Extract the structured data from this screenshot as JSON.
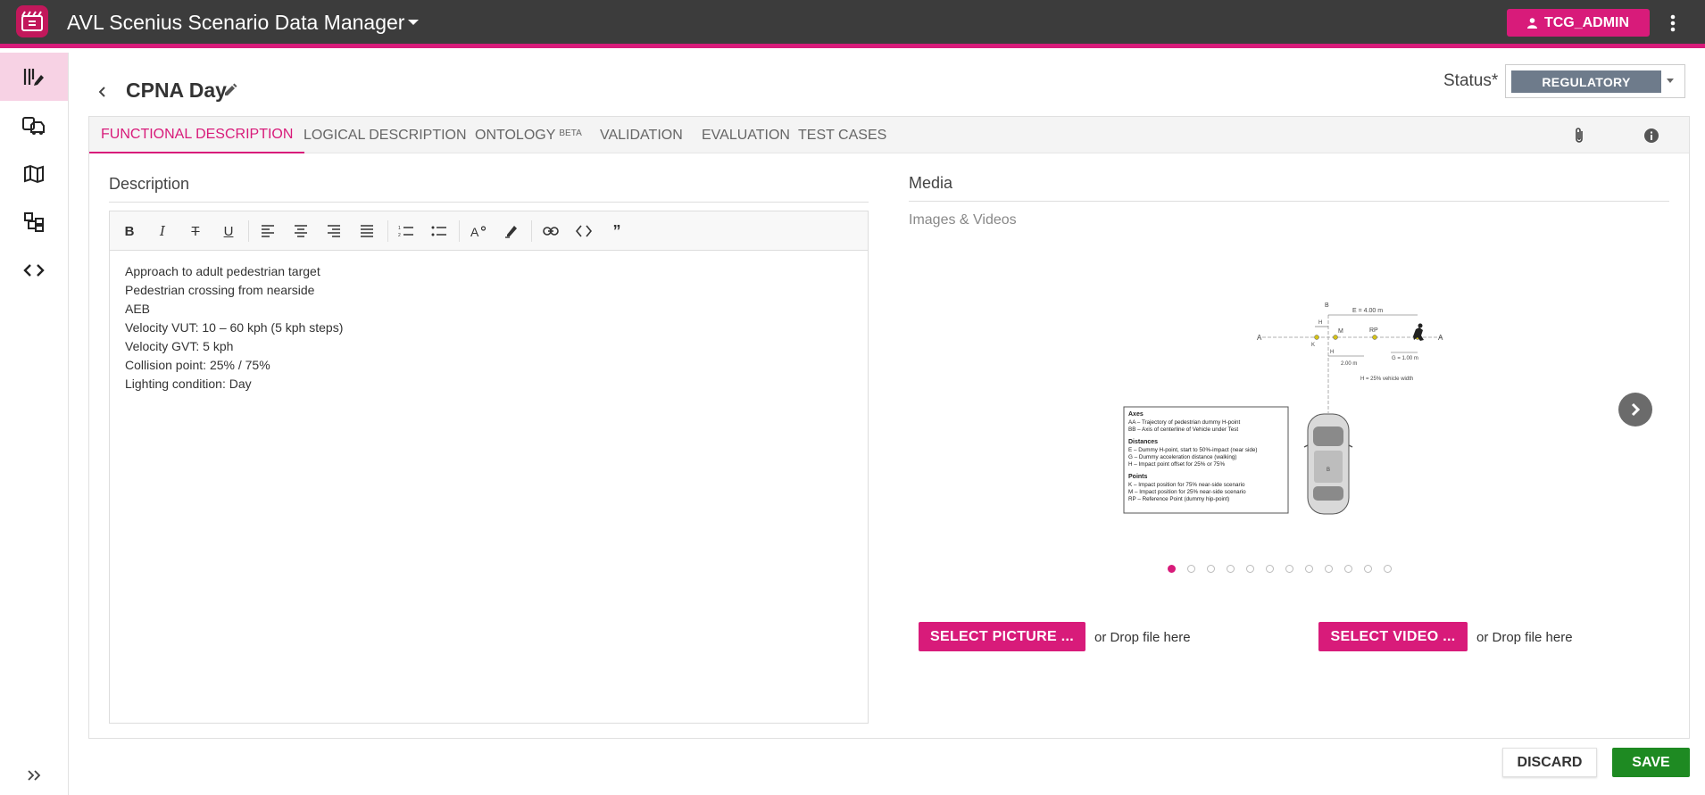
{
  "app": {
    "title": "AVL Scenius Scenario Data Manager",
    "user_label": "TCG_ADMIN",
    "brand_color": "#d81b7a"
  },
  "sidenav": {
    "items": [
      {
        "icon": "scenario-edit-icon",
        "active": true
      },
      {
        "icon": "vehicles-icon",
        "active": false
      },
      {
        "icon": "map-icon",
        "active": false
      },
      {
        "icon": "hierarchy-icon",
        "active": false
      },
      {
        "icon": "code-icon",
        "active": false
      }
    ],
    "expand_icon": "double-chevron-right-icon"
  },
  "header": {
    "title": "CPNA Day",
    "status_label": "Status*",
    "status_value": "REGULATORY"
  },
  "tabs": [
    {
      "label": "FUNCTIONAL DESCRIPTION",
      "active": true
    },
    {
      "label": "LOGICAL DESCRIPTION",
      "active": false
    },
    {
      "label": "ONTOLOGY",
      "badge": "BETA",
      "active": false
    },
    {
      "label": "VALIDATION",
      "active": false
    },
    {
      "label": "EVALUATION",
      "active": false
    },
    {
      "label": "TEST CASES",
      "active": false
    }
  ],
  "description": {
    "heading": "Description",
    "lines": [
      "Approach to adult pedestrian target",
      "Pedestrian crossing from nearside",
      "AEB",
      "Velocity VUT: 10 – 60 kph (5 kph steps)",
      "Velocity GVT: 5 kph",
      "Collision point: 25% / 75%",
      "Lighting condition: Day"
    ]
  },
  "media": {
    "heading": "Media",
    "subheading": "Images & Videos",
    "carousel_count": 12,
    "carousel_active_index": 0,
    "diagram": {
      "labels": {
        "a": "A",
        "b": "B",
        "h": "H",
        "k": "K",
        "m": "M",
        "rp": "RP",
        "e": "E = 4.00 m",
        "g": "G = 1.00 m",
        "d2": "2.00 m",
        "hnote": "H = 25% vehicle width"
      },
      "legend": [
        "Axes",
        "AA – Trajectory of pedestrian dummy H-point",
        "BB – Axis of centerline of Vehicle under Test",
        "Distances",
        "E – Dummy H-point, start to 50%-impact (near side)",
        "G – Dummy acceleration distance (walking)",
        "H – Impact point offset for 25% or 75%",
        "Points",
        "K – Impact position for 75% near-side scenario",
        "M – Impact position for 25% near-side scenario",
        "RP – Reference Point (dummy hip-point)"
      ]
    },
    "select_picture_label": "SELECT PICTURE ...",
    "select_video_label": "SELECT VIDEO ...",
    "drop_text": "or Drop file here"
  },
  "footer": {
    "discard_label": "DISCARD",
    "save_label": "SAVE"
  }
}
